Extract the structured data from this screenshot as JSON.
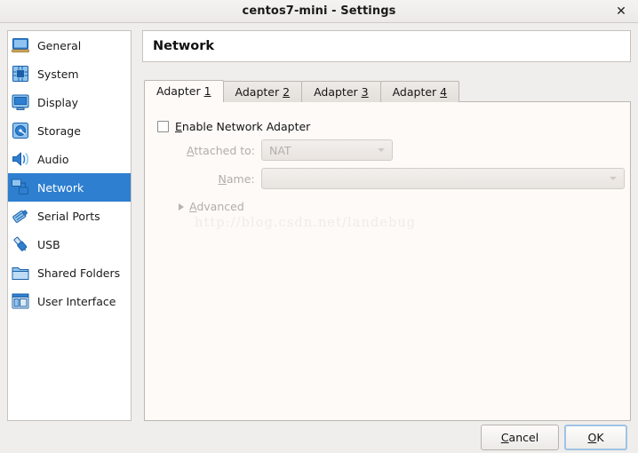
{
  "window": {
    "title": "centos7-mini - Settings",
    "close_label": "✕",
    "close_icon": "close-icon"
  },
  "sidebar": {
    "items": [
      {
        "label": "General",
        "icon": "monitor-icon",
        "selected": false
      },
      {
        "label": "System",
        "icon": "chip-icon",
        "selected": false
      },
      {
        "label": "Display",
        "icon": "display-icon",
        "selected": false
      },
      {
        "label": "Storage",
        "icon": "harddisk-icon",
        "selected": false
      },
      {
        "label": "Audio",
        "icon": "speaker-icon",
        "selected": false
      },
      {
        "label": "Network",
        "icon": "network-icon",
        "selected": true
      },
      {
        "label": "Serial Ports",
        "icon": "serial-port-icon",
        "selected": false
      },
      {
        "label": "USB",
        "icon": "usb-icon",
        "selected": false
      },
      {
        "label": "Shared Folders",
        "icon": "folder-icon",
        "selected": false
      },
      {
        "label": "User Interface",
        "icon": "user-interface-icon",
        "selected": false
      }
    ]
  },
  "main": {
    "page_title": "Network",
    "tabs": [
      {
        "label_prefix": "Adapter ",
        "mnemonic": "1",
        "active": true
      },
      {
        "label_prefix": "Adapter ",
        "mnemonic": "2",
        "active": false
      },
      {
        "label_prefix": "Adapter ",
        "mnemonic": "3",
        "active": false
      },
      {
        "label_prefix": "Adapter ",
        "mnemonic": "4",
        "active": false
      }
    ],
    "enable_adapter": {
      "mnemonic": "E",
      "label_rest": "nable Network Adapter",
      "checked": false
    },
    "attached_to": {
      "mnemonic": "A",
      "label_rest": "ttached to:",
      "value": "NAT",
      "enabled": false
    },
    "name_field": {
      "mnemonic": "N",
      "label_rest": "ame:",
      "value": "",
      "enabled": false
    },
    "advanced": {
      "mnemonic": "A",
      "label_rest": "dvanced",
      "expanded": false
    },
    "watermark": "http://blog.csdn.net/landebug"
  },
  "footer": {
    "cancel": {
      "mnemonic": "C",
      "prefix": "",
      "rest": "ancel"
    },
    "ok": {
      "mnemonic": "O",
      "prefix": "",
      "rest": "K"
    }
  },
  "colors": {
    "selection_blue": "#2e7fd0",
    "panel_bg": "#fdfaf7",
    "dialog_bg": "#f0eeec",
    "disabled_text": "#b3adaa"
  }
}
